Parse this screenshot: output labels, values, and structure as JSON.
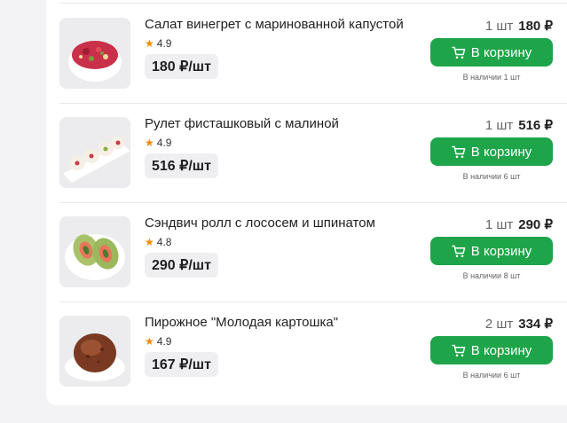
{
  "items": [
    {
      "name": "Салат винегрет с маринованной капустой",
      "rating": "4.9",
      "unit_price": "180 ₽/шт",
      "qty": "1 шт",
      "total": "180 ₽",
      "cart_label": "В корзину",
      "stock": "В наличии 1 шт"
    },
    {
      "name": "Рулет фисташковый с малиной",
      "rating": "4.9",
      "unit_price": "516 ₽/шт",
      "qty": "1 шт",
      "total": "516 ₽",
      "cart_label": "В корзину",
      "stock": "В наличии 6 шт"
    },
    {
      "name": "Сэндвич ролл с лососем и шпинатом",
      "rating": "4.8",
      "unit_price": "290 ₽/шт",
      "qty": "1 шт",
      "total": "290 ₽",
      "cart_label": "В корзину",
      "stock": "В наличии 8 шт"
    },
    {
      "name": "Пирожное \"Молодая картошка\"",
      "rating": "4.9",
      "unit_price": "167 ₽/шт",
      "qty": "2 шт",
      "total": "334 ₽",
      "cart_label": "В корзину",
      "stock": "В наличии 6 шт"
    }
  ],
  "colors": {
    "accent": "#1ea54a",
    "star": "#f08a00",
    "background": "#f3f3f5"
  },
  "icons": {
    "rating": "star-icon",
    "button": "cart-icon"
  }
}
